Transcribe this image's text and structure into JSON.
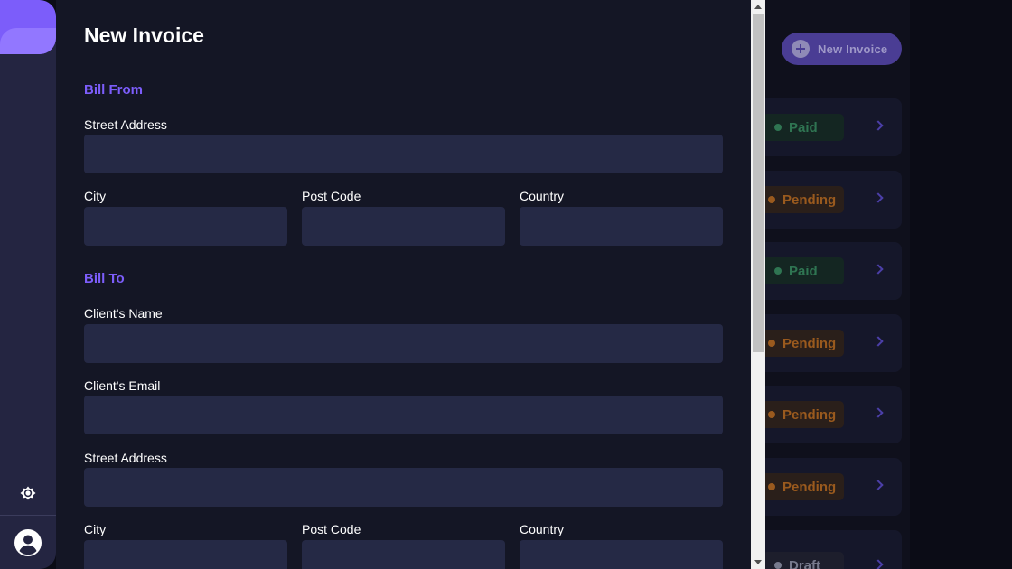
{
  "background": {
    "new_invoice_button": "New Invoice",
    "invoice_rows": [
      {
        "status": "Paid",
        "variant": "paid"
      },
      {
        "status": "Pending",
        "variant": "pending"
      },
      {
        "status": "Paid",
        "variant": "paid"
      },
      {
        "status": "Pending",
        "variant": "pending"
      },
      {
        "status": "Pending",
        "variant": "pending"
      },
      {
        "status": "Pending",
        "variant": "pending"
      },
      {
        "status": "Draft",
        "variant": "draft"
      }
    ]
  },
  "sidebar": {
    "theme_toggle_icon": "sun-icon",
    "avatar_icon": "account-circle-icon"
  },
  "form": {
    "title": "New Invoice",
    "bill_from": {
      "heading": "Bill From",
      "street_address_label": "Street Address",
      "street_address_value": "",
      "city_label": "City",
      "city_value": "",
      "post_code_label": "Post Code",
      "post_code_value": "",
      "country_label": "Country",
      "country_value": ""
    },
    "bill_to": {
      "heading": "Bill To",
      "client_name_label": "Client's Name",
      "client_name_value": "",
      "client_email_label": "Client's Email",
      "client_email_value": "",
      "street_address_label": "Street Address",
      "street_address_value": "",
      "city_label": "City",
      "city_value": "",
      "post_code_label": "Post Code",
      "post_code_value": "",
      "country_label": "Country",
      "country_value": ""
    }
  },
  "colors": {
    "accent": "#7c5dfa",
    "drawer_bg": "#141625",
    "input_bg": "#252945",
    "sidebar_bg": "#242541"
  }
}
